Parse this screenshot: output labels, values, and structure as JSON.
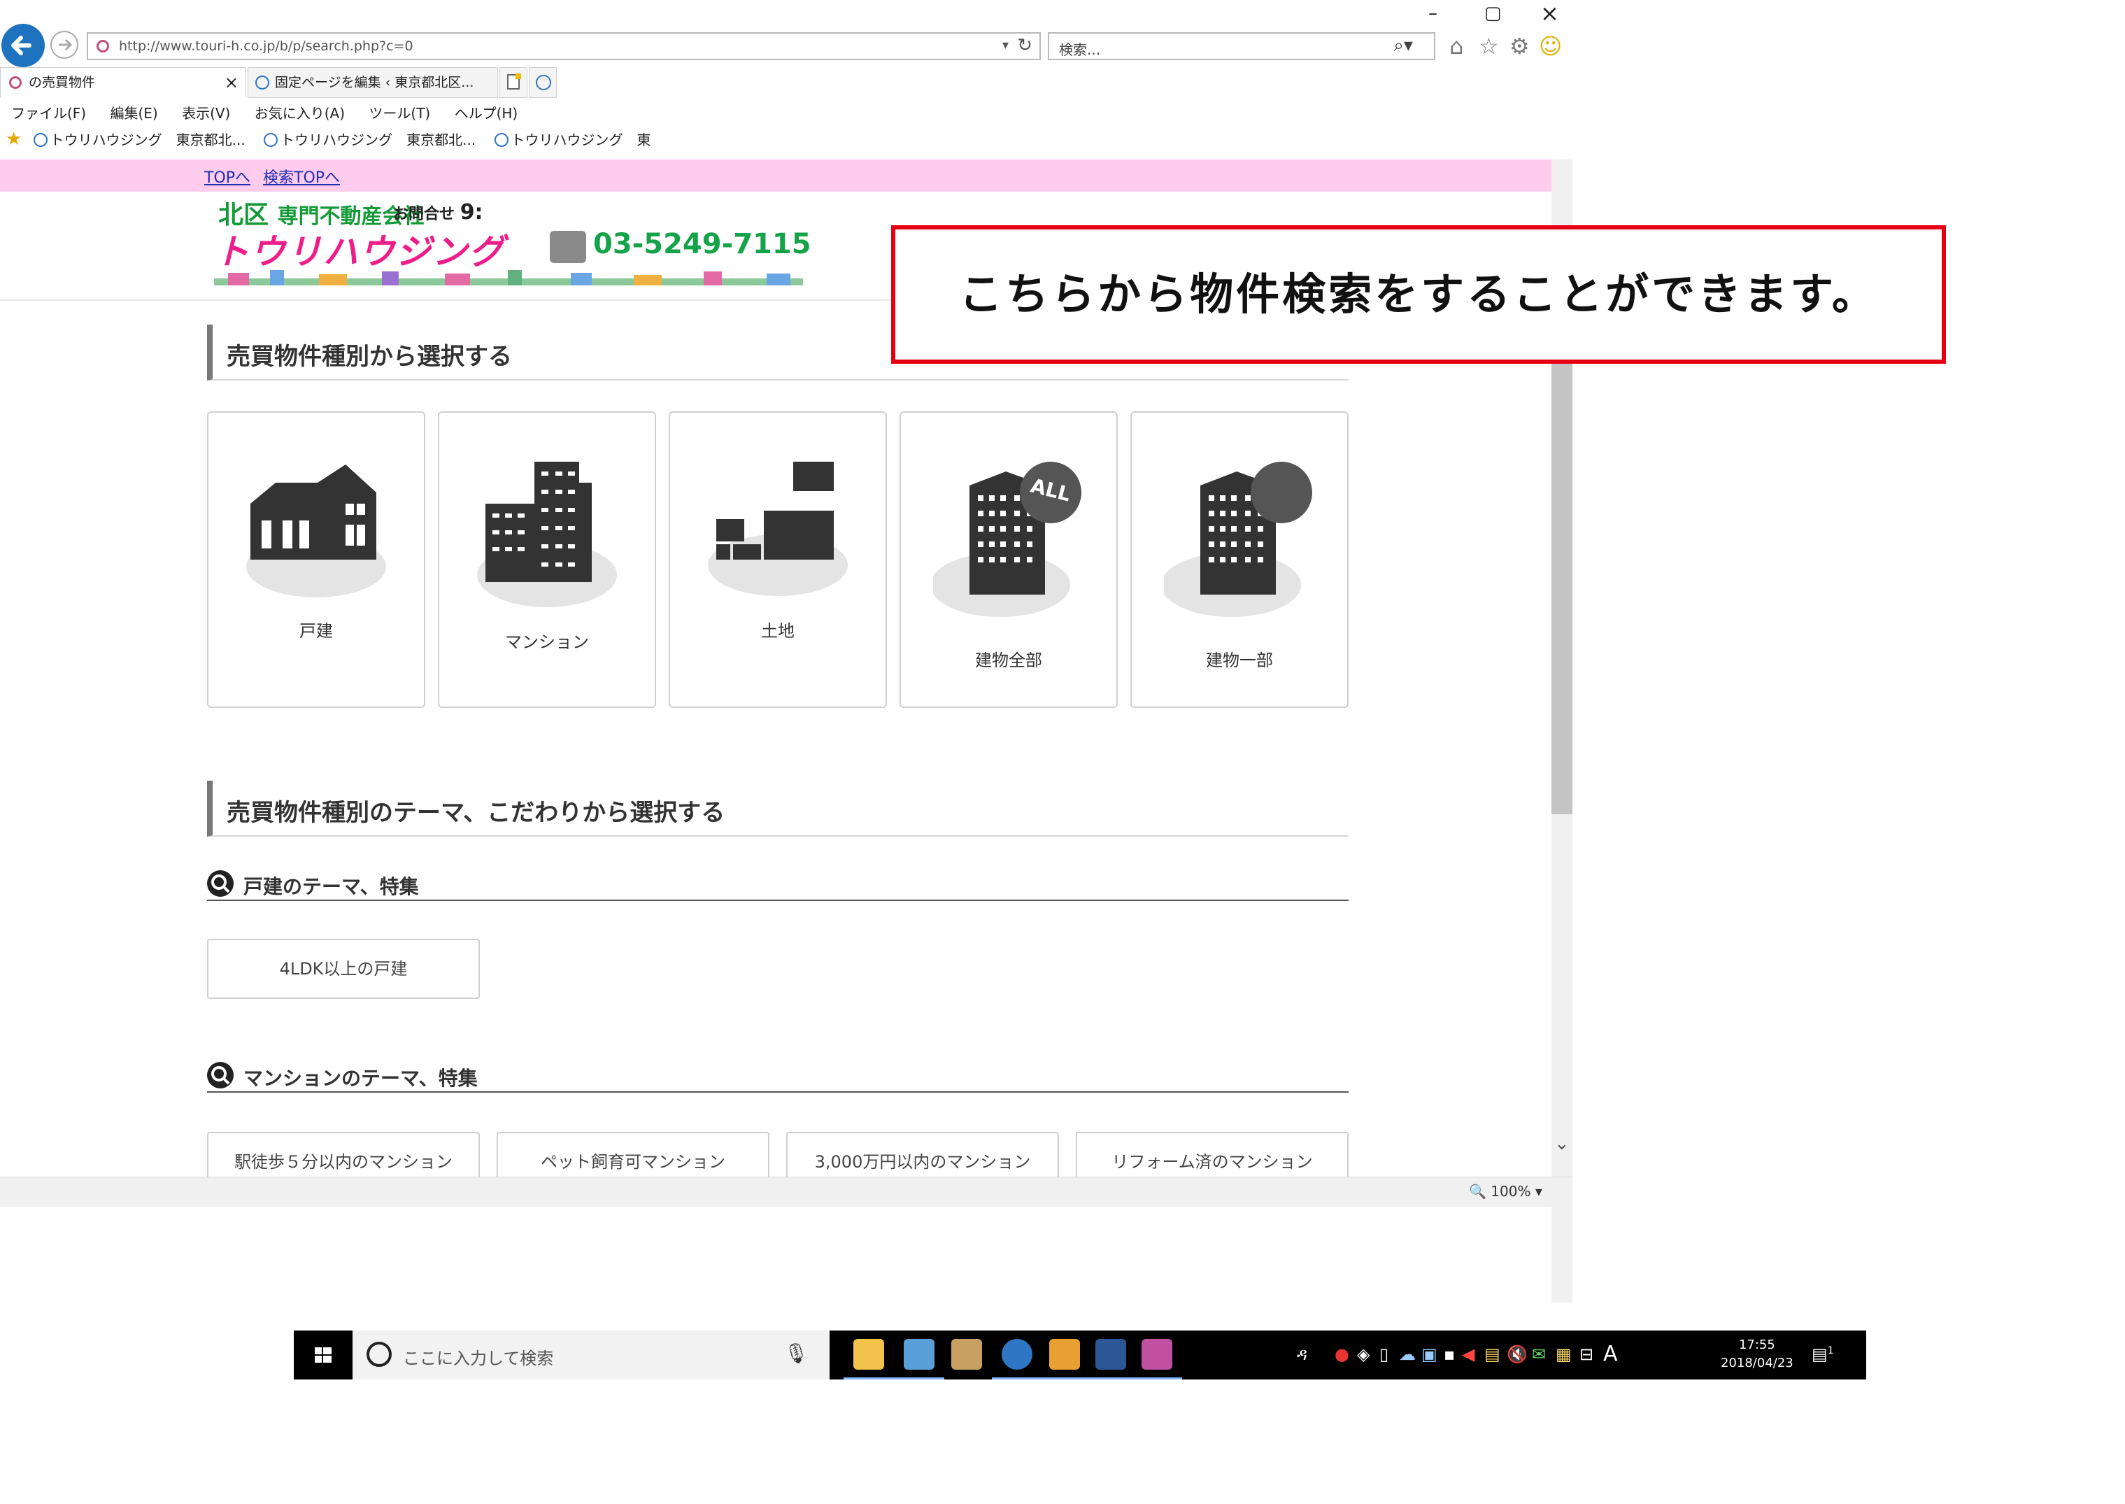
{
  "window": {
    "minimize": "–",
    "restore": "▢",
    "close": "×"
  },
  "address_bar": {
    "url": "http://www.touri-h.co.jp/b/p/search.php?c=0",
    "dropdown": "▾",
    "refresh": "↻"
  },
  "search_box": {
    "placeholder": "検索...",
    "icon": "⌕▾"
  },
  "toolbar_icons": {
    "home": "⌂",
    "favorites": "☆",
    "settings": "⚙",
    "smiley": "☺"
  },
  "tabs": [
    {
      "label": "の売買物件",
      "close": "×"
    },
    {
      "label": "固定ページを編集 ‹ 東京都北区..."
    }
  ],
  "menu": [
    "ファイル(F)",
    "編集(E)",
    "表示(V)",
    "お気に入り(A)",
    "ツール(T)",
    "ヘルプ(H)"
  ],
  "favorites": [
    {
      "label": "トウリハウジング　東京都北..."
    },
    {
      "label": "トウリハウジング　東京都北..."
    },
    {
      "label": "トウリハウジング　東"
    }
  ],
  "pink_links": [
    "TOPへ",
    "検索TOPへ"
  ],
  "logo": {
    "kita": "北区",
    "company_type": "専門不動産会社",
    "contact_label": "お問合せ",
    "contact_hours_partial": "9:",
    "name": "トウリハウジング",
    "tel": "03-5249-7115"
  },
  "section1": {
    "title": "売買物件種別から選択する",
    "cards": [
      {
        "label": "戸建",
        "icon": "house-icon"
      },
      {
        "label": "マンション",
        "icon": "apartment-icon"
      },
      {
        "label": "土地",
        "icon": "land-icon"
      },
      {
        "label": "建物全部",
        "icon": "building-all-icon",
        "badge": "ALL"
      },
      {
        "label": "建物一部",
        "icon": "building-part-icon"
      }
    ]
  },
  "section2": {
    "title": "売買物件種別のテーマ、こだわりから選択する",
    "house_theme": {
      "title": "戸建のテーマ、特集",
      "buttons": [
        "4LDK以上の戸建"
      ]
    },
    "mansion_theme": {
      "title": "マンションのテーマ、特集",
      "buttons": [
        "駅徒歩５分以内のマンション",
        "ペット飼育可マンション",
        "3,000万円以内のマンション",
        "リフォーム済のマンション"
      ]
    }
  },
  "statusbar": {
    "zoom": "100%",
    "zoom_dd": "▾"
  },
  "taskbar": {
    "search_placeholder": "ここに入力して検索",
    "mic": "🎙",
    "time": "17:55",
    "date": "2018/04/23",
    "ime": "A",
    "notif_count": "1"
  },
  "callout": {
    "text": "こちらから物件検索をすることができます。",
    "border_color": "#e60012"
  },
  "colors": {
    "pink_bar": "#ffccee",
    "logo_green": "#15a34a",
    "logo_pink": "#ef1d8a",
    "link_blue": "#1f2fb5"
  }
}
